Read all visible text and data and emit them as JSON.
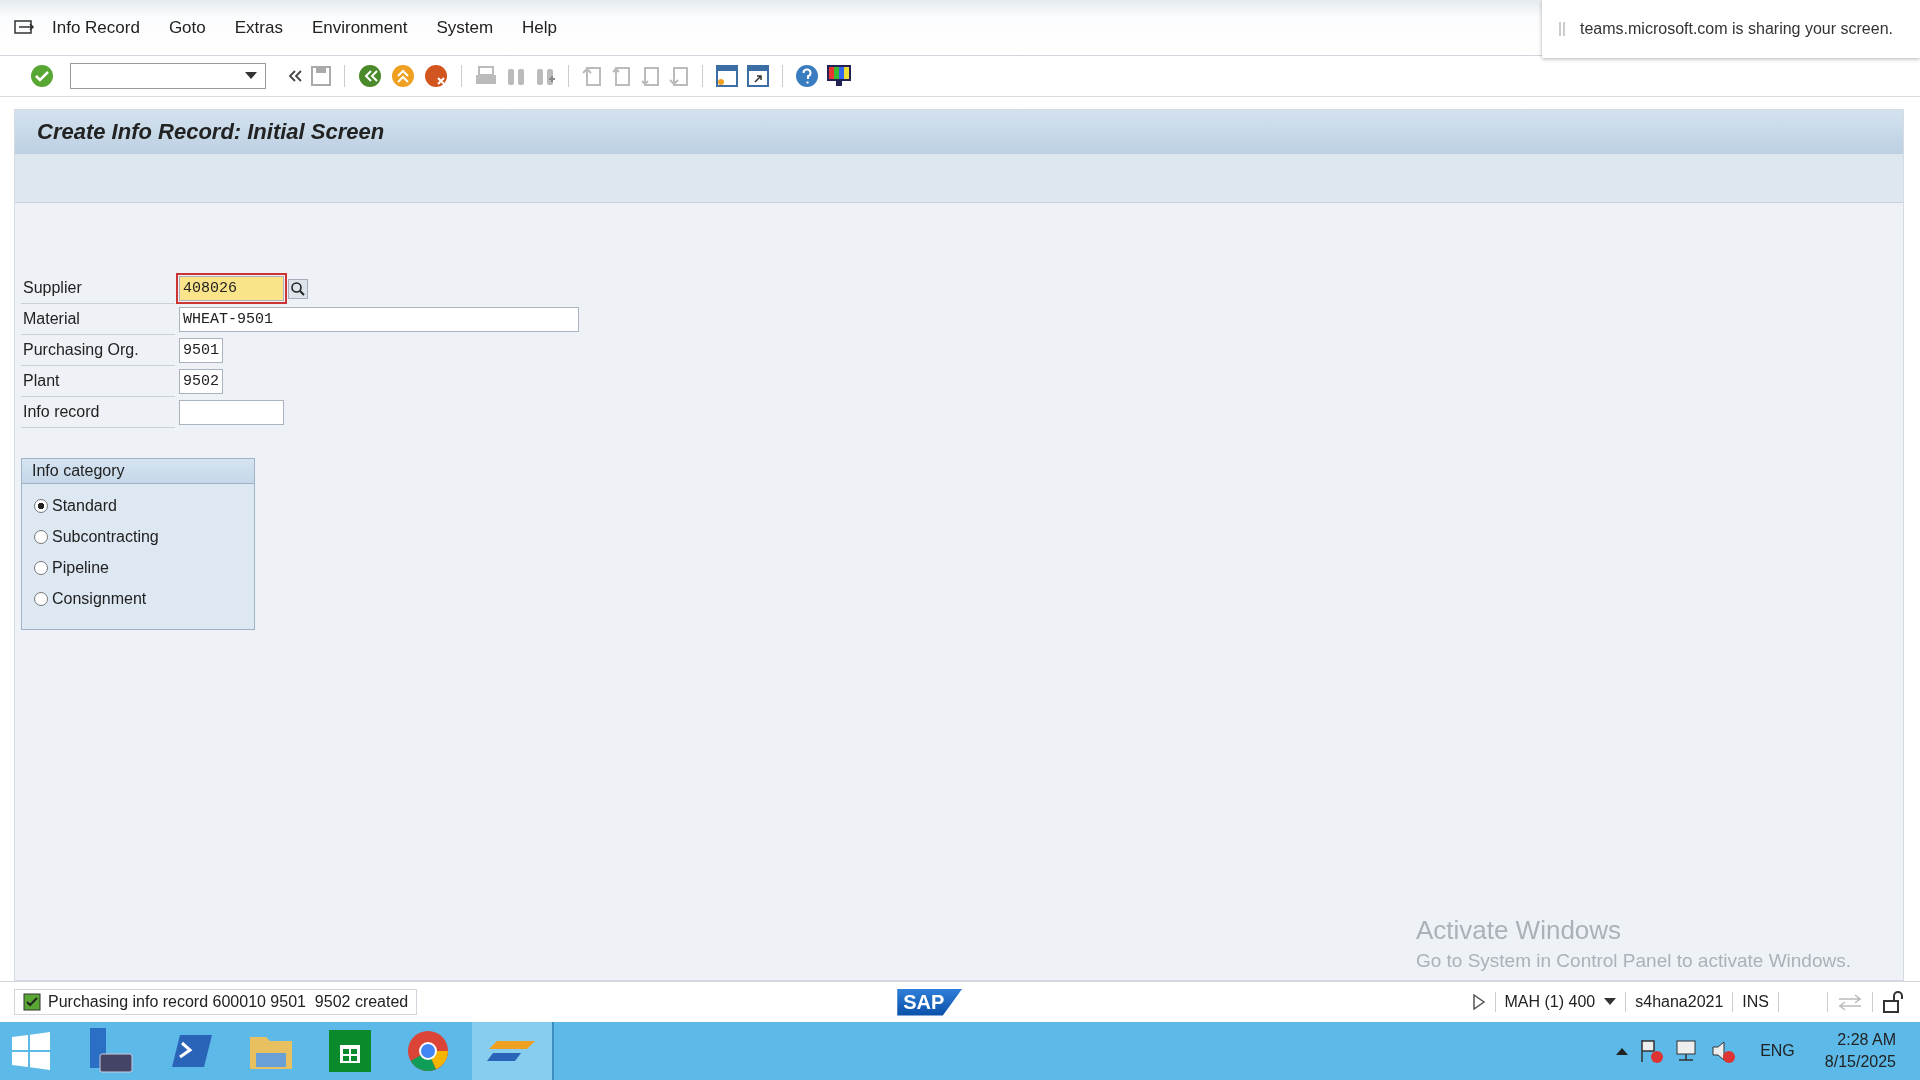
{
  "menu_bar": {
    "items": [
      "Info Record",
      "Goto",
      "Extras",
      "Environment",
      "System",
      "Help"
    ]
  },
  "notification": {
    "text": "teams.microsoft.com is sharing your screen."
  },
  "title": "Create Info Record: Initial Screen",
  "fields": [
    {
      "label": "Supplier",
      "value": "408026",
      "focused": true,
      "has_search": true
    },
    {
      "label": "Material",
      "value": "WHEAT-9501",
      "focused": false,
      "has_search": false
    },
    {
      "label": "Purchasing Org.",
      "value": "9501",
      "focused": false,
      "has_search": false
    },
    {
      "label": "Plant",
      "value": "9502",
      "focused": false,
      "has_search": false
    },
    {
      "label": "Info record",
      "focused": false,
      "has_search": false
    }
  ],
  "info_category": {
    "title": "Info category",
    "options": [
      {
        "label": "Standard",
        "selected": true
      },
      {
        "label": "Subcontracting",
        "selected": false
      },
      {
        "label": "Pipeline",
        "selected": false
      },
      {
        "label": "Consignment",
        "selected": false
      }
    ]
  },
  "os_notice": {
    "title": "Activate Windows",
    "text": "Go to System in Control Panel to activate Windows."
  },
  "status_bar": {
    "message": "Purchasing info record 600010 9501  9502 created",
    "logo": "SAP",
    "session": "MAH (1) 400",
    "server": "s4hana2021",
    "mode": "INS"
  },
  "taskbar": {
    "language": "ENG",
    "time": "2:28 AM",
    "date": "8/15/2025"
  }
}
